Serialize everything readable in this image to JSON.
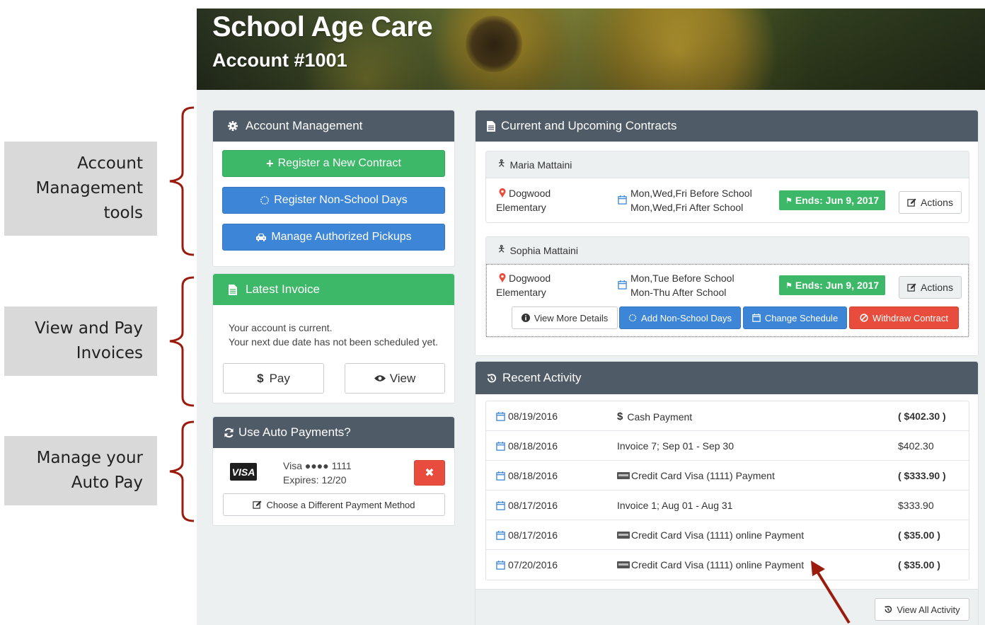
{
  "annotations": {
    "account_mgmt": [
      "Account",
      "Management",
      "tools"
    ],
    "invoices": [
      "View and Pay",
      "Invoices"
    ],
    "autopay": [
      "Manage your",
      "Auto Pay"
    ]
  },
  "header": {
    "title": "School Age Care",
    "account": "Account #1001"
  },
  "account_management": {
    "title": "Account Management",
    "register_contract": "Register a New Contract",
    "register_nonschool": "Register Non-School Days",
    "manage_pickups": "Manage Authorized Pickups"
  },
  "latest_invoice": {
    "title": "Latest Invoice",
    "line1": "Your account is current.",
    "line2": "Your next due date has not been scheduled yet.",
    "pay": "Pay",
    "view": "View"
  },
  "autopay": {
    "title": "Use Auto Payments?",
    "card_brand": "VISA",
    "card_line": "Visa ●●●● 1111",
    "expires": "Expires: 12/20",
    "choose": "Choose a Different Payment Method"
  },
  "contracts": {
    "title": "Current and Upcoming Contracts",
    "children": [
      {
        "name": "Maria Mattaini",
        "school_line1": "Dogwood",
        "school_line2": "Elementary",
        "schedule_line1": "Mon,Wed,Fri Before School",
        "schedule_line2": "Mon,Wed,Fri After School",
        "ends": "Ends: Jun 9, 2017",
        "actions": "Actions"
      },
      {
        "name": "Sophia Mattaini",
        "school_line1": "Dogwood",
        "school_line2": "Elementary",
        "schedule_line1": "Mon,Tue Before School",
        "schedule_line2": "Mon-Thu After School",
        "ends": "Ends: Jun 9, 2017",
        "actions": "Actions",
        "view_details": "View More Details",
        "add_nonschool": "Add Non-School Days",
        "change_schedule": "Change Schedule",
        "withdraw": "Withdraw Contract"
      }
    ]
  },
  "activity": {
    "title": "Recent Activity",
    "rows": [
      {
        "date": "08/19/2016",
        "desc": "Cash  Payment",
        "amount": "( $402.30 )",
        "icon": "dollar"
      },
      {
        "date": "08/18/2016",
        "desc": "Invoice 7; Sep 01 - Sep 30",
        "amount": "$402.30",
        "icon": "none"
      },
      {
        "date": "08/18/2016",
        "desc": "Credit Card Visa (1111)  Payment",
        "amount": "( $333.90 )",
        "icon": "card"
      },
      {
        "date": "08/17/2016",
        "desc": "Invoice 1; Aug 01 - Aug 31",
        "amount": "$333.90",
        "icon": "none"
      },
      {
        "date": "08/17/2016",
        "desc": "Credit Card Visa (1111) online  Payment",
        "amount": "( $35.00 )",
        "icon": "card"
      },
      {
        "date": "07/20/2016",
        "desc": "Credit Card Visa (1111) online  Payment",
        "amount": "( $35.00 )",
        "icon": "card"
      }
    ],
    "view_all": "View All Activity"
  },
  "colors": {
    "accent_green": "#3cb868",
    "accent_blue": "#3d85d6",
    "danger": "#e74c3c",
    "panel_head": "#4f5b66",
    "annotation": "#9b1c0c"
  }
}
